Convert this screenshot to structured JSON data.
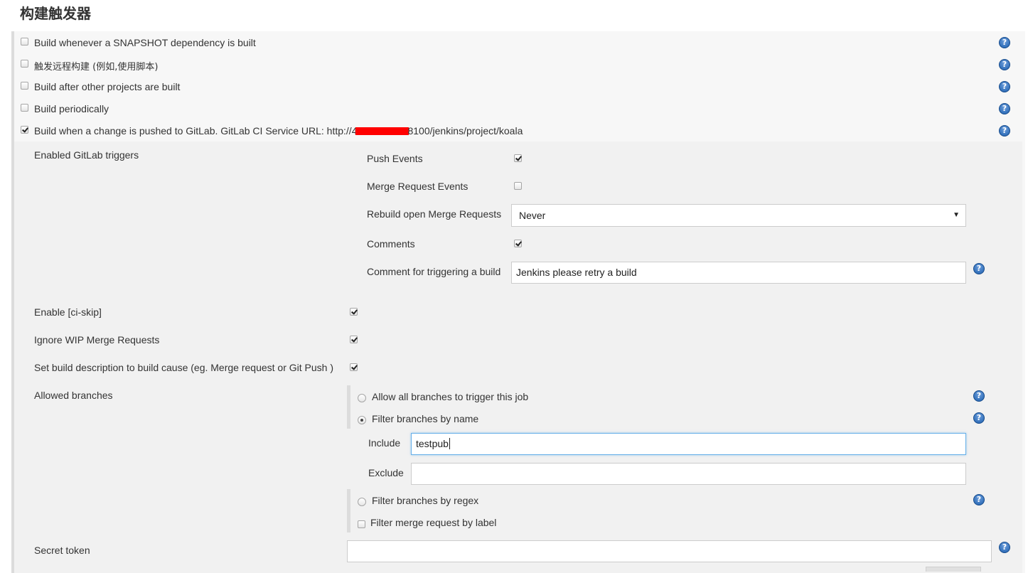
{
  "section_title": "构建触发器",
  "triggers": [
    {
      "label": "Build whenever a SNAPSHOT dependency is built",
      "checked": false
    },
    {
      "label": "触发远程构建 (例如,使用脚本)",
      "checked": false
    },
    {
      "label": "Build after other projects are built",
      "checked": false
    },
    {
      "label": "Build periodically",
      "checked": false
    },
    {
      "label": "Build when a change is pushed to GitLab. GitLab CI Service URL: http://4",
      "label_suffix": "8100/jenkins/project/koala",
      "checked": true
    }
  ],
  "gitlab": {
    "enabled_triggers_label": "Enabled GitLab triggers",
    "push_events_label": "Push Events",
    "push_events_checked": true,
    "merge_request_events_label": "Merge Request Events",
    "merge_request_events_checked": false,
    "rebuild_label": "Rebuild open Merge Requests",
    "rebuild_value": "Never",
    "comments_label": "Comments",
    "comments_checked": true,
    "comment_trigger_label": "Comment for triggering a build",
    "comment_trigger_value": "Jenkins please retry a build",
    "ci_skip_label": "Enable [ci-skip]",
    "ci_skip_checked": true,
    "ignore_wip_label": "Ignore WIP Merge Requests",
    "ignore_wip_checked": true,
    "set_desc_label": "Set build description to build cause (eg. Merge request or Git Push )",
    "set_desc_checked": true,
    "allowed_branches_label": "Allowed branches",
    "allow_all_label": "Allow all branches to trigger this job",
    "filter_name_label": "Filter branches by name",
    "include_label": "Include",
    "include_value": "testpub",
    "exclude_label": "Exclude",
    "exclude_value": "",
    "filter_regex_label": "Filter branches by regex",
    "filter_label_label": "Filter merge request by label",
    "secret_token_label": "Secret token",
    "secret_token_value": ""
  },
  "icons": {
    "help": "help-icon",
    "redaction": "red-redaction-mark"
  },
  "colors": {
    "help_blue": "#1d5fae",
    "redaction_red": "#ff0000",
    "focus_border": "#66afe9"
  }
}
